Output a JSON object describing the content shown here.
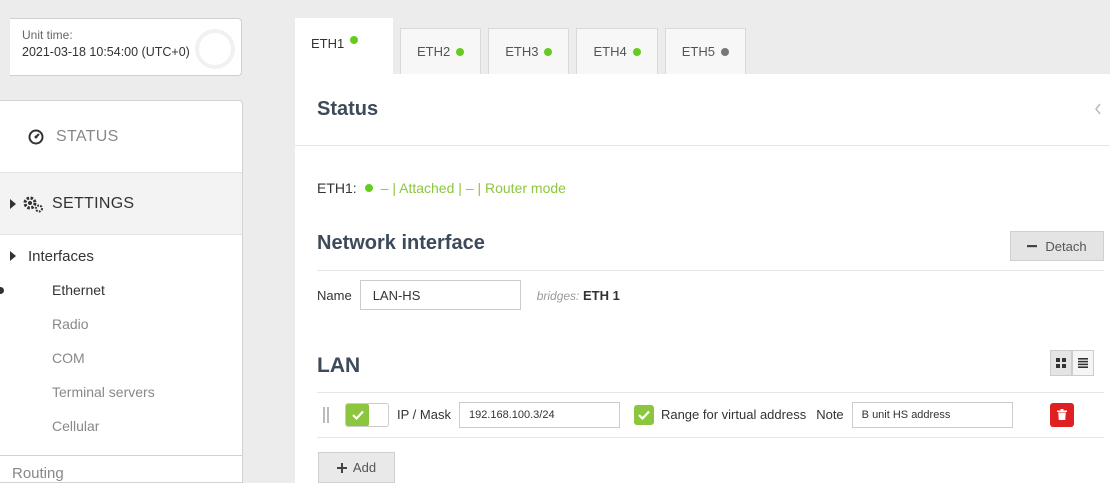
{
  "unit_time": {
    "label": "Unit time:",
    "value": "2021-03-18 10:54:00 (UTC+0)"
  },
  "sidebar": {
    "status_label": "STATUS",
    "settings_label": "SETTINGS",
    "interfaces_label": "Interfaces",
    "sub_items": [
      "Ethernet",
      "Radio",
      "COM",
      "Terminal servers",
      "Cellular"
    ],
    "routing_label": "Routing"
  },
  "tabs": [
    {
      "label": "ETH1",
      "status": "green"
    },
    {
      "label": "ETH2",
      "status": "green"
    },
    {
      "label": "ETH3",
      "status": "green"
    },
    {
      "label": "ETH4",
      "status": "green"
    },
    {
      "label": "ETH5",
      "status": "grey"
    }
  ],
  "colors": {
    "green": "#66cc1f",
    "grey": "#777777",
    "accent_green": "#8cc63f",
    "delete_red": "#e02020",
    "heading": "#3d4a5a"
  },
  "status_section": {
    "title": "Status",
    "collapse_icon": "chevron-left-icon",
    "line_label": "ETH1:",
    "line_text": "– | Attached | – | Router mode"
  },
  "network_interface": {
    "title": "Network interface",
    "detach_label": "Detach",
    "name_label": "Name",
    "name_value": "LAN-HS",
    "bridges_label": "bridges:",
    "bridges_value": "ETH 1"
  },
  "lan": {
    "title": "LAN",
    "ip_mask_label": "IP / Mask",
    "ip_mask_value": "192.168.100.3/24",
    "range_label": "Range for virtual address",
    "note_label": "Note",
    "note_value": "B unit HS address",
    "add_label": "Add"
  }
}
